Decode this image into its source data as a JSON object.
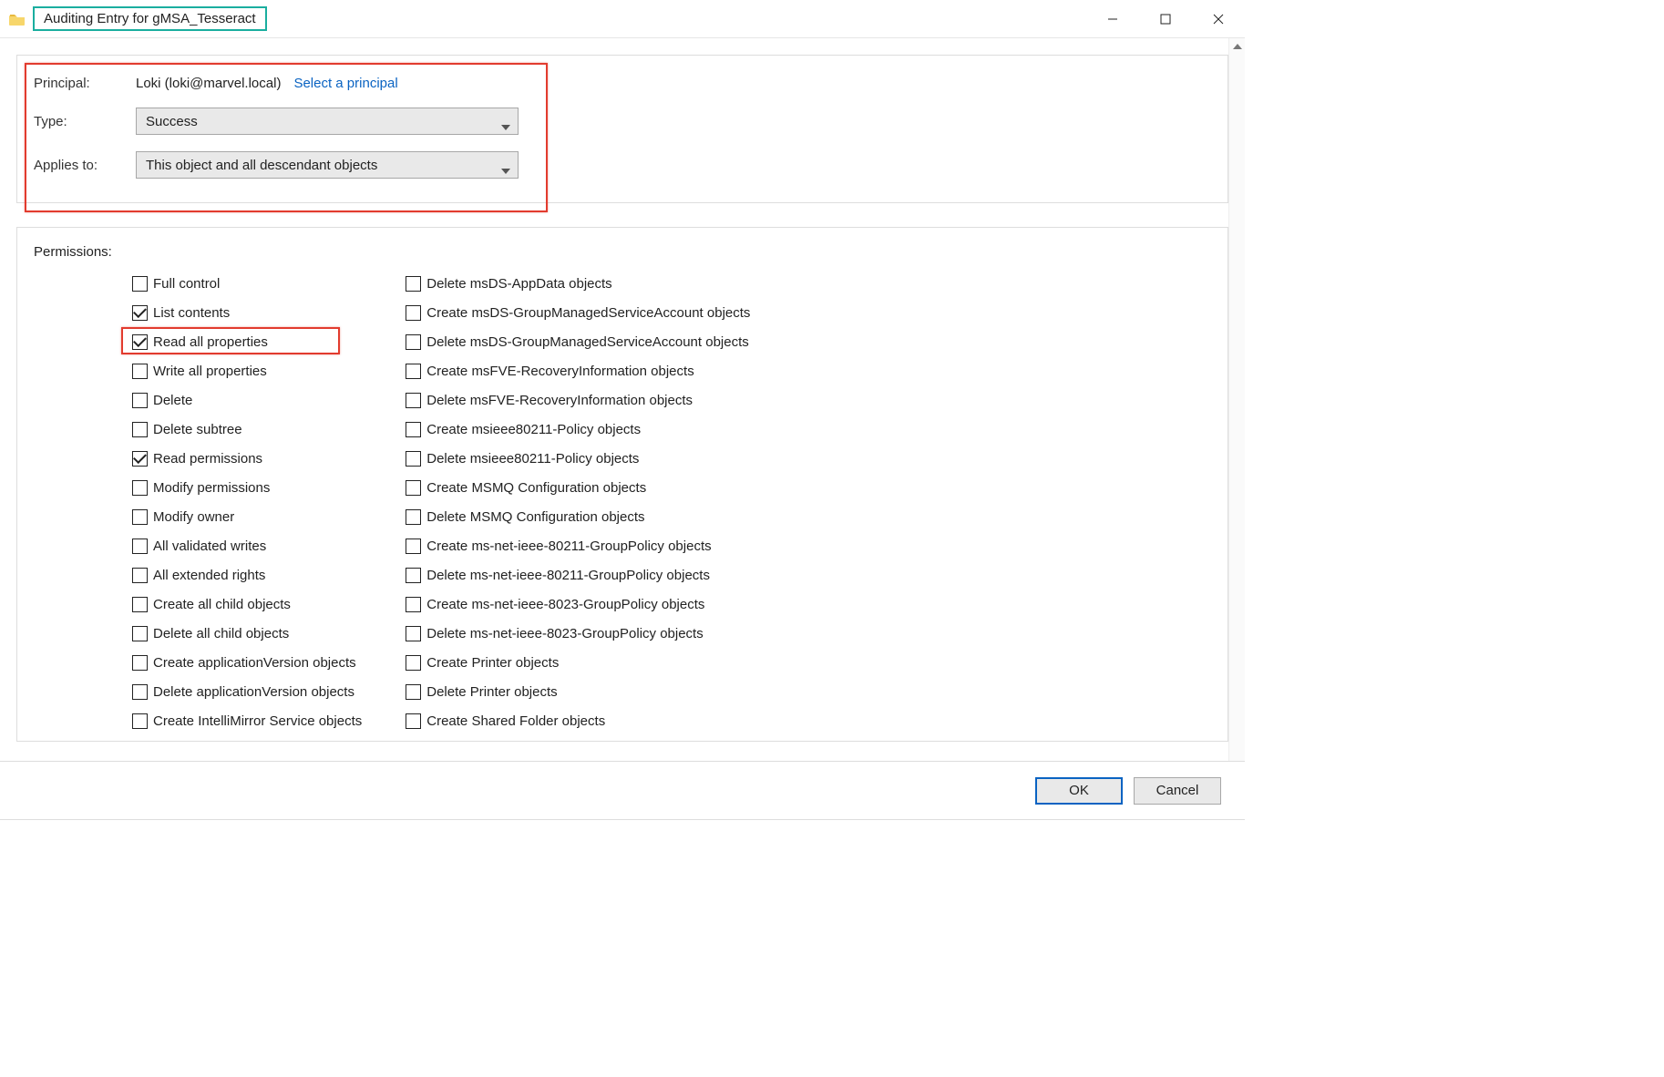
{
  "window": {
    "title": "Auditing Entry for gMSA_Tesseract"
  },
  "principal": {
    "label": "Principal:",
    "value": "Loki  (loki@marvel.local)",
    "select_link": "Select a principal"
  },
  "type": {
    "label": "Type:",
    "value": "Success"
  },
  "applies": {
    "label": "Applies to:",
    "value": "This object and all descendant objects"
  },
  "permissions": {
    "label": "Permissions:",
    "left": [
      {
        "label": "Full control",
        "checked": false
      },
      {
        "label": "List contents",
        "checked": true
      },
      {
        "label": "Read all properties",
        "checked": true,
        "highlight": true
      },
      {
        "label": "Write all properties",
        "checked": false
      },
      {
        "label": "Delete",
        "checked": false
      },
      {
        "label": "Delete subtree",
        "checked": false
      },
      {
        "label": "Read permissions",
        "checked": true
      },
      {
        "label": "Modify permissions",
        "checked": false
      },
      {
        "label": "Modify owner",
        "checked": false
      },
      {
        "label": "All validated writes",
        "checked": false
      },
      {
        "label": "All extended rights",
        "checked": false
      },
      {
        "label": "Create all child objects",
        "checked": false
      },
      {
        "label": "Delete all child objects",
        "checked": false
      },
      {
        "label": "Create applicationVersion objects",
        "checked": false
      },
      {
        "label": "Delete applicationVersion objects",
        "checked": false
      },
      {
        "label": "Create IntelliMirror Service objects",
        "checked": false
      }
    ],
    "right": [
      {
        "label": "Delete msDS-AppData objects",
        "checked": false
      },
      {
        "label": "Create msDS-GroupManagedServiceAccount objects",
        "checked": false
      },
      {
        "label": "Delete msDS-GroupManagedServiceAccount objects",
        "checked": false
      },
      {
        "label": "Create msFVE-RecoveryInformation objects",
        "checked": false
      },
      {
        "label": "Delete msFVE-RecoveryInformation objects",
        "checked": false
      },
      {
        "label": "Create msieee80211-Policy objects",
        "checked": false
      },
      {
        "label": "Delete msieee80211-Policy objects",
        "checked": false
      },
      {
        "label": "Create MSMQ Configuration objects",
        "checked": false
      },
      {
        "label": "Delete MSMQ Configuration objects",
        "checked": false
      },
      {
        "label": "Create ms-net-ieee-80211-GroupPolicy objects",
        "checked": false
      },
      {
        "label": "Delete ms-net-ieee-80211-GroupPolicy objects",
        "checked": false
      },
      {
        "label": "Create ms-net-ieee-8023-GroupPolicy objects",
        "checked": false
      },
      {
        "label": "Delete ms-net-ieee-8023-GroupPolicy objects",
        "checked": false
      },
      {
        "label": "Create Printer objects",
        "checked": false
      },
      {
        "label": "Delete Printer objects",
        "checked": false
      },
      {
        "label": "Create Shared Folder objects",
        "checked": false
      }
    ]
  },
  "buttons": {
    "ok": "OK",
    "cancel": "Cancel"
  }
}
